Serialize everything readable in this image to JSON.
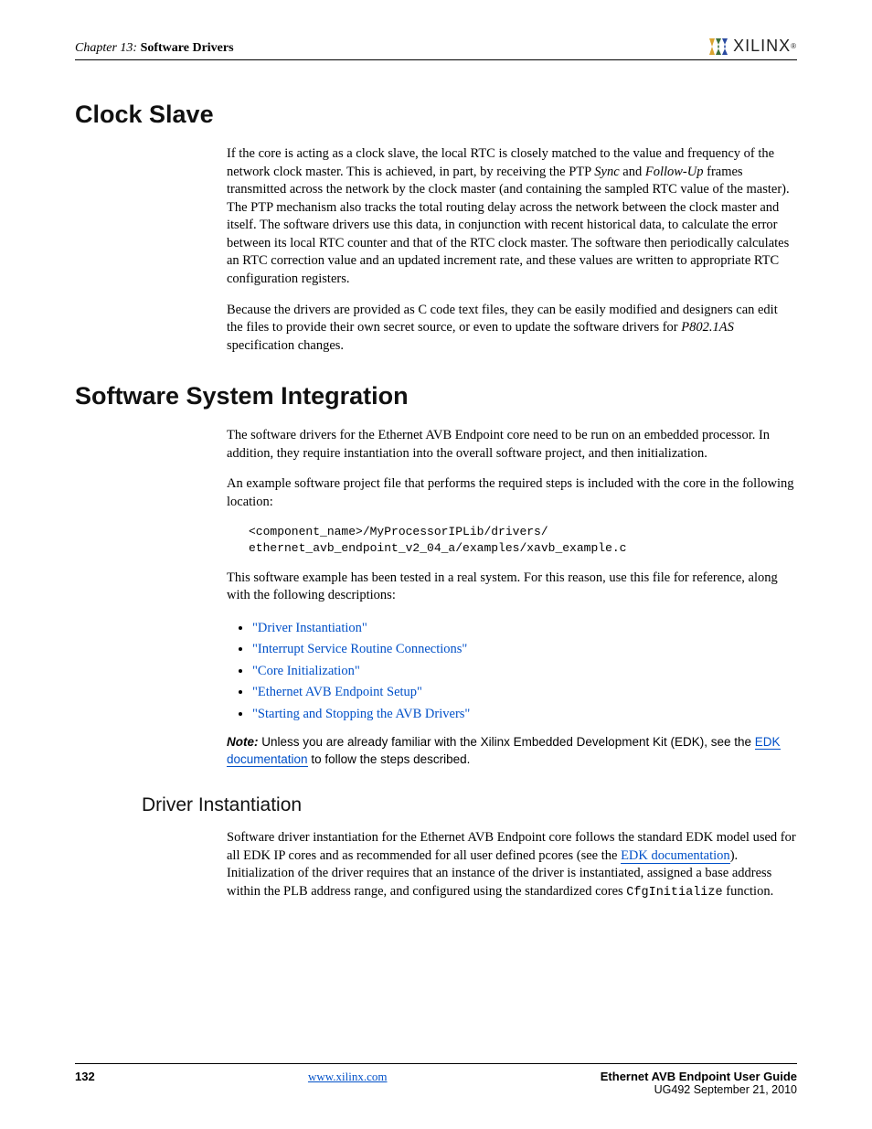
{
  "header": {
    "chapter_prefix": "Chapter 13:",
    "chapter_title": "Software Drivers",
    "logo_text": "XILINX"
  },
  "sections": {
    "clock_slave": {
      "heading": "Clock Slave",
      "p1_a": "If the core is acting as a clock slave, the local RTC is closely matched to the value and frequency of the network clock master. This is achieved, in part, by receiving the PTP ",
      "p1_sync": "Sync",
      "p1_b": " and ",
      "p1_follow": "Follow-Up",
      "p1_c": " frames transmitted across the network by the clock master (and containing the sampled RTC value of the master). The PTP mechanism also tracks the total routing delay across the network between the clock master and itself. The software drivers use this data, in conjunction with recent historical data, to calculate the error between its local RTC counter and that of the RTC clock master. The software then periodically calculates an RTC correction value and an updated increment rate, and these values are written to appropriate RTC configuration registers.",
      "p2_a": "Because the drivers are provided as C code text files, they can be easily modified and designers can edit the files to provide their own secret source, or even to update the software drivers for ",
      "p2_spec": "P802.1AS",
      "p2_b": " specification changes."
    },
    "ssi": {
      "heading": "Software System Integration",
      "p1": "The software drivers for the Ethernet AVB Endpoint core need to be run on an embedded processor. In addition, they require instantiation into the overall software project, and then initialization.",
      "p2": "An example software project file that performs the required steps is included with the core in the following location:",
      "code": "<component_name>/MyProcessorIPLib/drivers/\nethernet_avb_endpoint_v2_04_a/examples/xavb_example.c",
      "p3": "This software example has been tested in a real system. For this reason, use this file for reference, along with the following descriptions:",
      "links": [
        "\"Driver Instantiation\"",
        "\"Interrupt Service Routine Connections\"",
        "\"Core Initialization\"",
        "\"Ethernet AVB Endpoint Setup\"",
        "\"Starting and Stopping the AVB Drivers\""
      ],
      "note_label": "Note:",
      "note_a": "  Unless you are already familiar with the Xilinx Embedded Development Kit (EDK), see the ",
      "note_link": "EDK documentation",
      "note_b": " to follow the steps described."
    },
    "driver_inst": {
      "heading": "Driver Instantiation",
      "p1_a": "Software driver instantiation for the Ethernet AVB Endpoint core follows the standard EDK model used for all EDK IP cores and as recommended for all user defined pcores (see the ",
      "p1_link": "EDK documentation",
      "p1_b": "). Initialization of the driver requires that an instance of the driver is instantiated, assigned a base address within the PLB address range, and configured using the standardized cores ",
      "p1_code": "CfgInitialize",
      "p1_c": " function."
    }
  },
  "footer": {
    "page": "132",
    "url": "www.xilinx.com",
    "title": "Ethernet AVB Endpoint User Guide",
    "sub": "UG492 September 21, 2010"
  }
}
